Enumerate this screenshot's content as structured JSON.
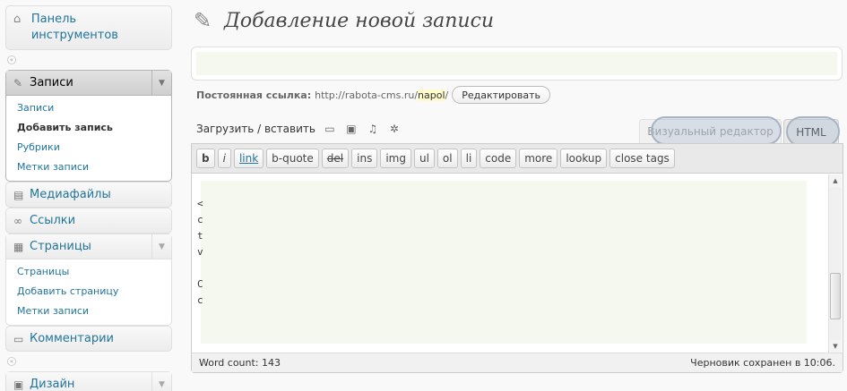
{
  "sidebar": {
    "dashboard": {
      "label": "Панель инструментов",
      "icon": "home-icon"
    },
    "posts": {
      "label": "Записи",
      "icon": "pin-icon",
      "items": [
        "Записи",
        "Добавить запись",
        "Рубрики",
        "Метки записи"
      ],
      "current_index": 1
    },
    "media": {
      "label": "Медиафайлы",
      "icon": "media-icon"
    },
    "links": {
      "label": "Ссылки",
      "icon": "link-icon"
    },
    "pages": {
      "label": "Страницы",
      "icon": "pages-icon",
      "items": [
        "Страницы",
        "Добавить страницу",
        "Метки записи"
      ]
    },
    "comments": {
      "label": "Комментарии",
      "icon": "comments-icon"
    },
    "design": {
      "label": "Дизайн",
      "icon": "design-icon"
    }
  },
  "header": {
    "title": "Добавление новой записи",
    "icon": "pushpin-icon"
  },
  "permalink": {
    "label": "Постоянная ссылка:",
    "url_base": "http://rabota-cms.ru/",
    "slug": "napol",
    "url_end": "/",
    "edit_button": "Редактировать"
  },
  "upload": {
    "label": "Загрузить / вставить",
    "icons": [
      "image-icon",
      "video-icon",
      "audio-icon",
      "media-gear-icon"
    ]
  },
  "editor_tabs": {
    "visual": "Визуальный редактор",
    "html": "HTML"
  },
  "quicktags": [
    "b",
    "i",
    "link",
    "b-quote",
    "del",
    "ins",
    "img",
    "ul",
    "ol",
    "li",
    "code",
    "more",
    "lookup",
    "close tags"
  ],
  "editor_text_chars": [
    "<",
    "c",
    "t",
    "v",
    "",
    "C",
    "c"
  ],
  "status": {
    "word_count": "Word count: 143",
    "draft_saved": "Черновик сохранен в 10:06."
  },
  "colors": {
    "link": "#21759b",
    "editor_fill": "#f5f8ee",
    "highlight": "#a8b4c4"
  }
}
